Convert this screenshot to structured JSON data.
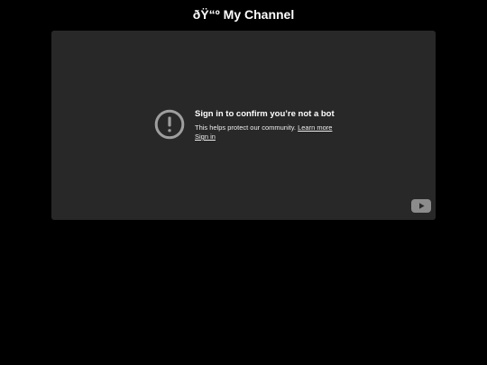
{
  "page": {
    "title": "ðŸ“º My Channel"
  },
  "player": {
    "message_title": "Sign in to confirm you’re not a bot",
    "message_body": "This helps protect our community.",
    "learn_more_label": "Learn more",
    "sign_in_label": "Sign in",
    "alert_icon": "alert-circle-icon",
    "logo_icon": "youtube-logo-icon",
    "colors": {
      "background": "#000000",
      "player_background": "#282828",
      "icon_gray": "#9e9e9e"
    }
  }
}
